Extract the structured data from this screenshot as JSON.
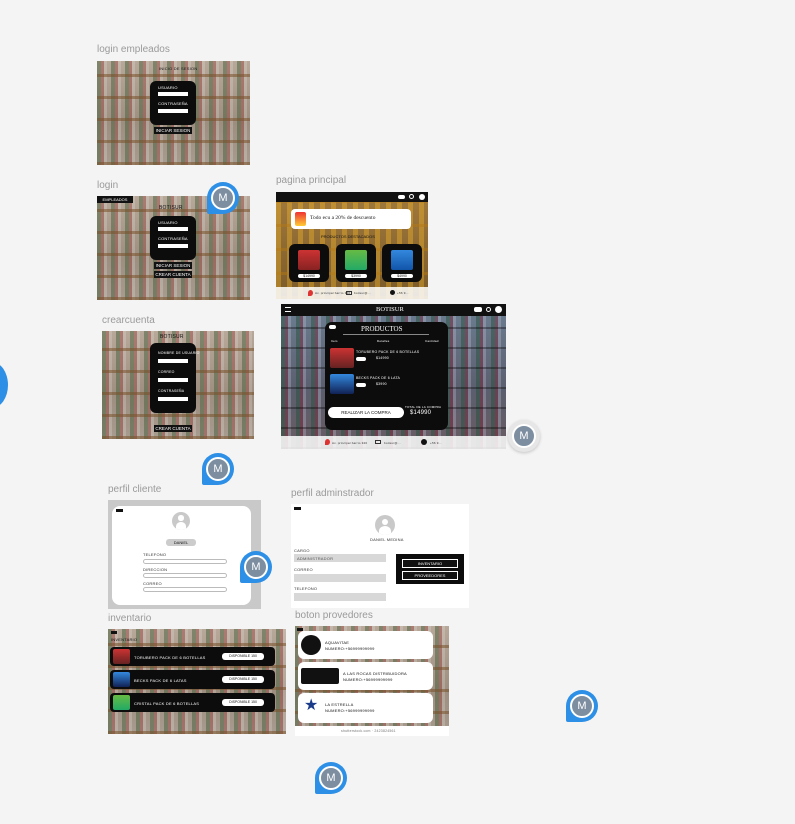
{
  "frames": {
    "login_empleados": {
      "label": "login empleados",
      "brand": "INICIO DE SESION",
      "usuario": "USUARIO",
      "contrasena": "CONTRASEÑA",
      "login_button": "INICIAR SESION"
    },
    "login": {
      "label": "login",
      "tab": "EMPLEADOS",
      "brand": "BOTISUR",
      "usuario": "USUARIO",
      "contrasena": "CONTRASEÑA",
      "login_button": "INICIAR SESION",
      "create_button": "CREAR CUENTA"
    },
    "pagina_principal": {
      "label": "pagina principal",
      "promo": "Todo ecu a 20% de descuento",
      "section": "PRODUCTOS DESTACADOS",
      "prices": [
        "$14990",
        "$3990",
        "$4990"
      ],
      "footer_address": "Av. principal barrio 320",
      "footer_mail": "botisur@...",
      "footer_phone": "+56 9..."
    },
    "carrito": {
      "brand": "BOTISUR",
      "title": "PRODUCTOS",
      "columns": [
        "Item",
        "Detalles",
        "Cantidad"
      ],
      "items": [
        {
          "name": "TORUBERO PACK DE 6 BOTELLAS",
          "price": "$14990"
        },
        {
          "name": "BECKS PACK DE 6 LATA",
          "price": "$3990"
        }
      ],
      "buy_button": "REALIZAR LA COMPRA",
      "total_label": "TOTAL DE LA COMPRA",
      "total_value": "$14990",
      "footer_address": "Av. principal barrio 320",
      "footer_mail": "botisur@...",
      "footer_phone": "+56 9..."
    },
    "crearcuenta": {
      "label": "crearcuenta",
      "brand": "BOTISUR",
      "fields": [
        "NOMBRE DE USUARIO",
        "CORREO",
        "CONTRASEÑA"
      ],
      "create_button": "CREAR CUENTA"
    },
    "perfil_cliente": {
      "label": "perfil cliente",
      "name": "DANIEL",
      "fields": [
        "TELEFONO",
        "DIRECCION",
        "CORREO"
      ]
    },
    "perfil_admin": {
      "label": "perfil adminstrador",
      "name": "DANIEL MEDINA",
      "cargo_label": "CARGO",
      "cargo_value": "ADMINISTRADOR",
      "correo_label": "CORREO",
      "telefono_label": "TELEFONO",
      "btn_inventario": "INVENTARIO",
      "btn_proveedores": "PROVEEDORES"
    },
    "inventario": {
      "label": "inventario",
      "heading": "INVENTARIO",
      "rows": [
        {
          "name": "TORUBERO PACK DE 6 BOTELLAS",
          "status": "DISPONIBLE",
          "qty": "150"
        },
        {
          "name": "BECKS PACK DE 6 LATAS",
          "status": "DISPONIBLE",
          "qty": "150"
        },
        {
          "name": "CRISTAL PACK DE 6 BOTELLAS",
          "status": "DISPONIBLE",
          "qty": "150"
        }
      ]
    },
    "boton_proveedores": {
      "label": "boton provedores",
      "providers": [
        {
          "name": "AQUAVITAE",
          "phone": "NUMERO:+56999999999"
        },
        {
          "name": "A LAS ROCAS DISTRIBUIDORA",
          "phone": "NUMERO:+56999999999"
        },
        {
          "name": "LA ESTRELLA",
          "phone": "NUMERO:+56999999999"
        }
      ],
      "watermark": "shutterstock.com · 2423824561"
    }
  },
  "avatars": {
    "letter": "M"
  },
  "colors": {
    "accent_blue": "#2d8fe6",
    "panel_black": "#0c0c0c",
    "canvas": "#f4f4f4"
  }
}
